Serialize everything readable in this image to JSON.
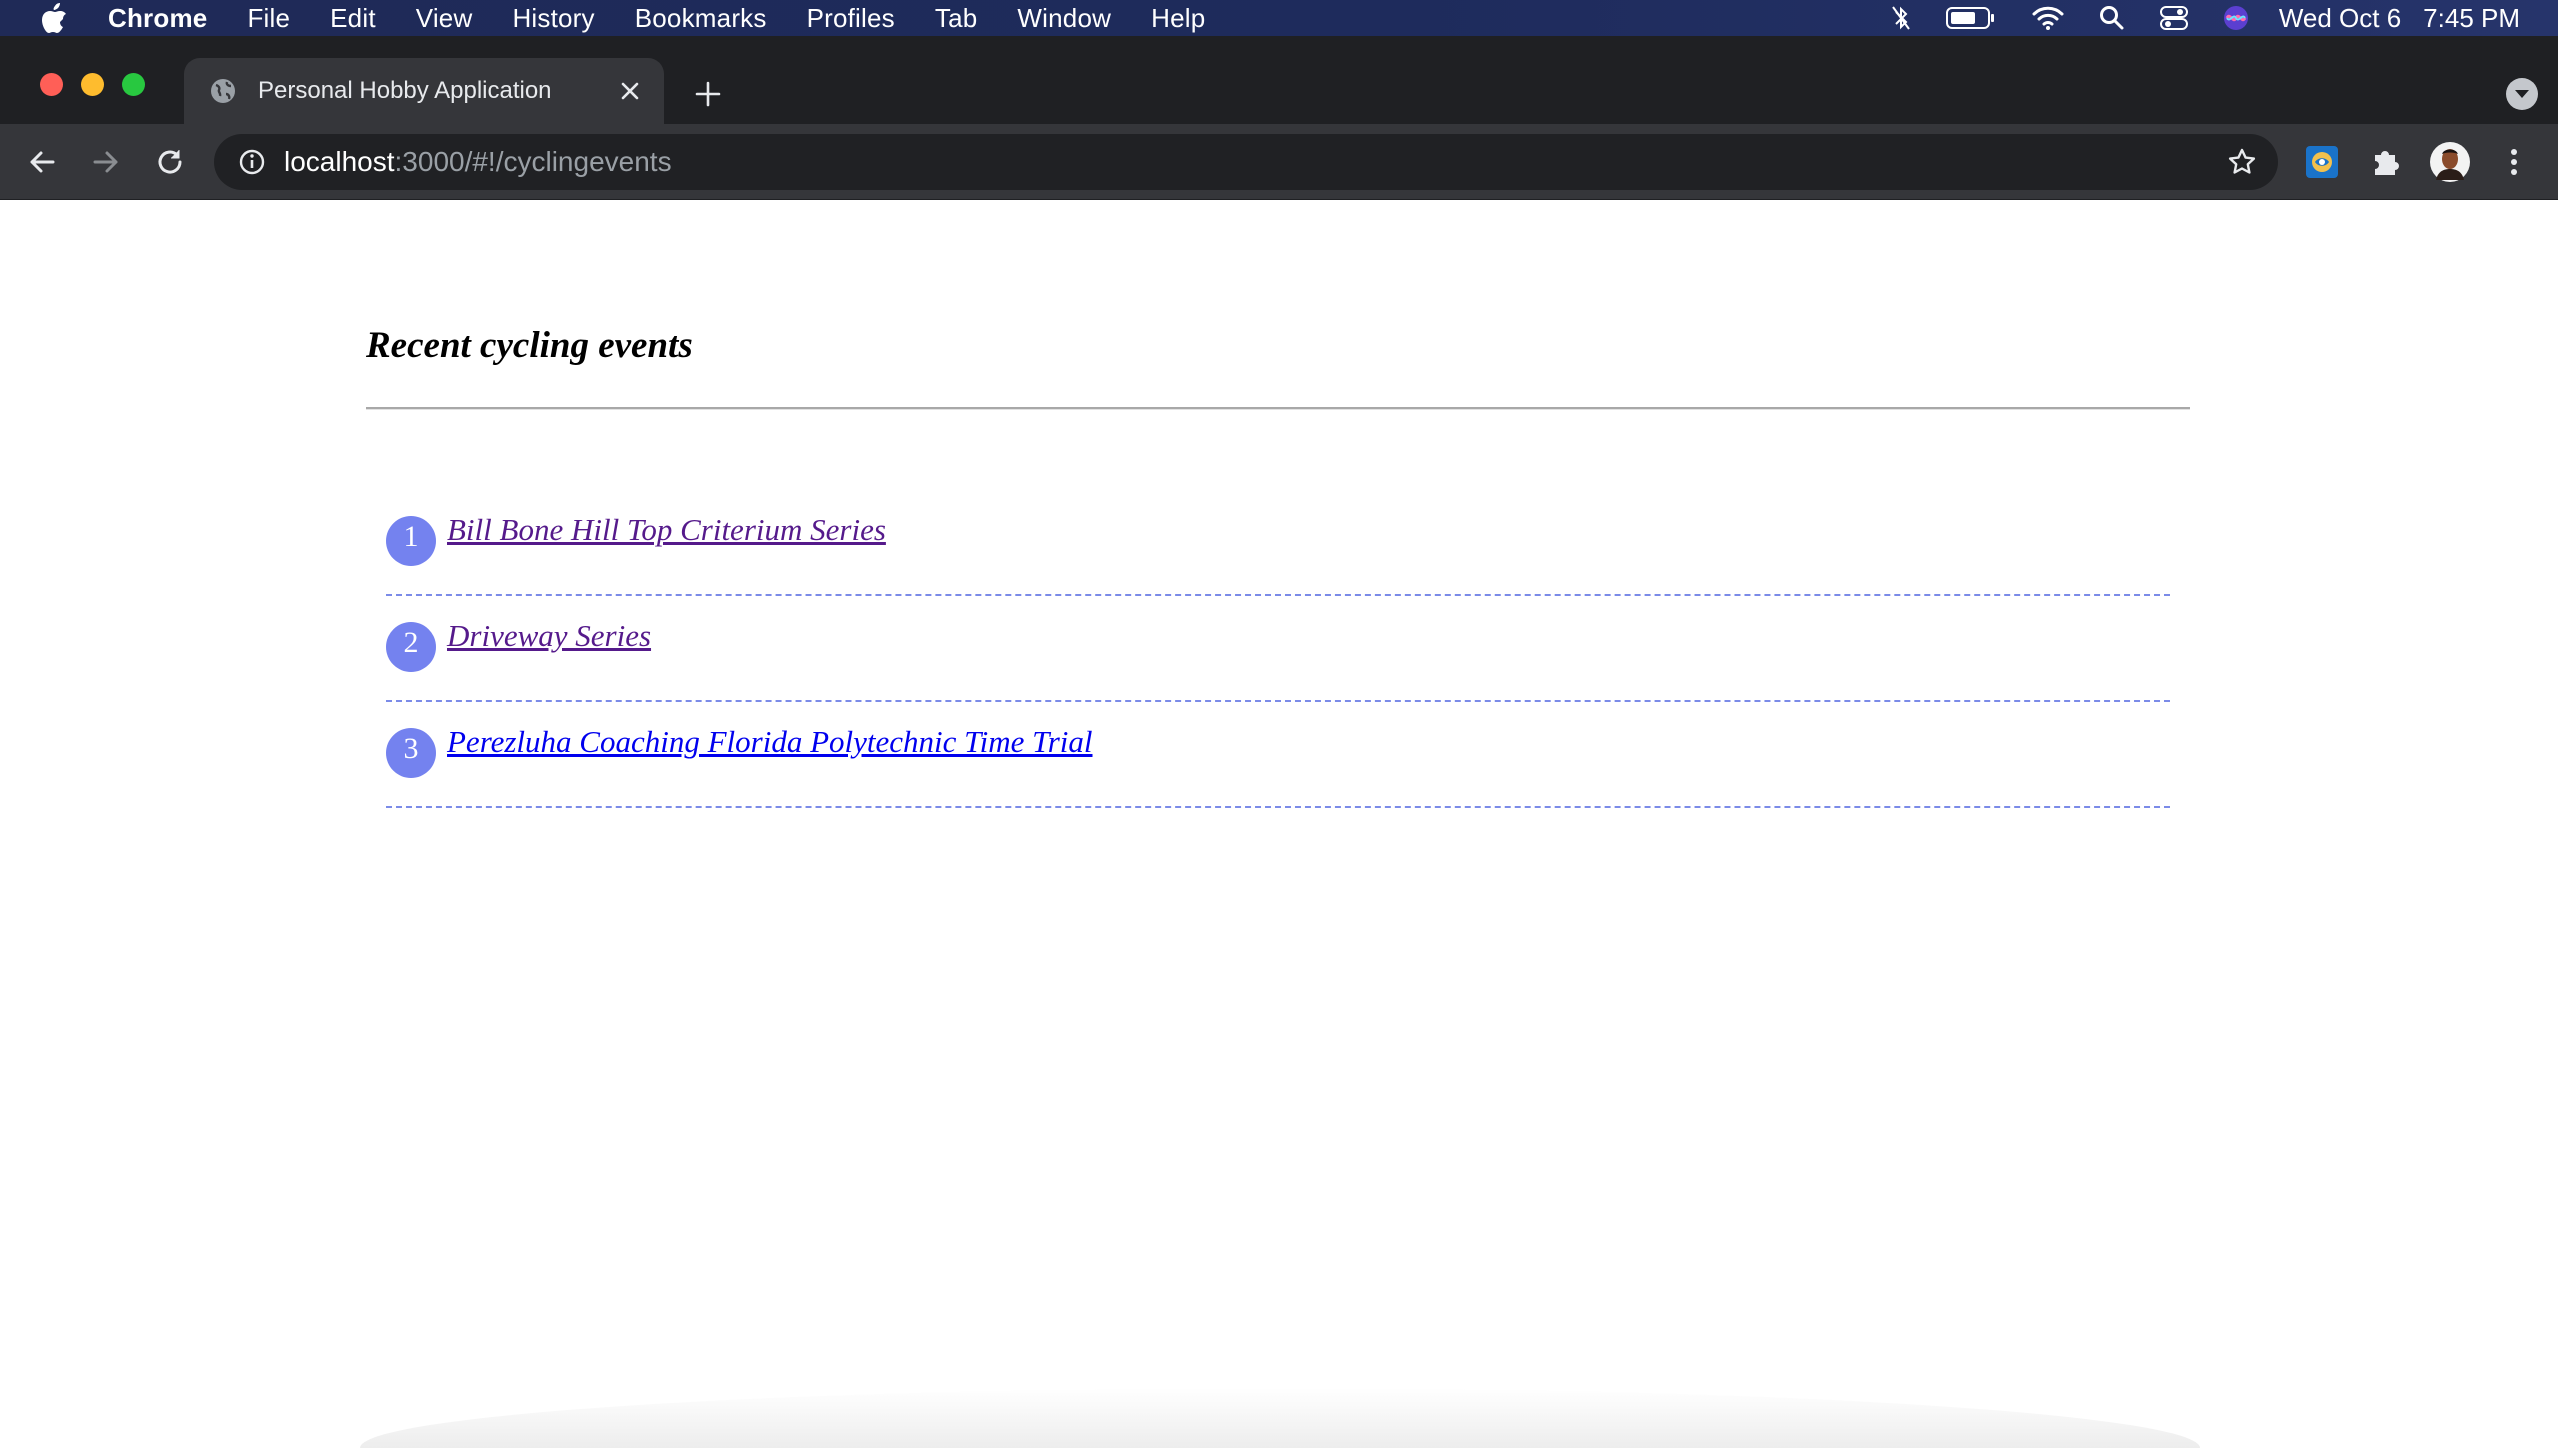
{
  "menubar": {
    "app_name": "Chrome",
    "items": [
      "File",
      "Edit",
      "View",
      "History",
      "Bookmarks",
      "Profiles",
      "Tab",
      "Window",
      "Help"
    ],
    "clock_day": "Wed Oct 6",
    "clock_time": "7:45 PM"
  },
  "browser": {
    "tab_title": "Personal Hobby Application",
    "url_host": "localhost",
    "url_path": ":3000/#!/cyclingevents"
  },
  "page": {
    "title": "Recent cycling events",
    "events": [
      {
        "number": "1",
        "name": "Bill Bone Hill Top Criterium Series",
        "visited": true
      },
      {
        "number": "2",
        "name": "Driveway Series",
        "visited": true
      },
      {
        "number": "3",
        "name": "Perezluha Coaching Florida Polytechnic Time Trial",
        "visited": false
      }
    ]
  },
  "colors": {
    "badge": "#7482ef",
    "divider": "#7b8be8",
    "visited_link": "#551a8b",
    "link": "#0000ee"
  }
}
